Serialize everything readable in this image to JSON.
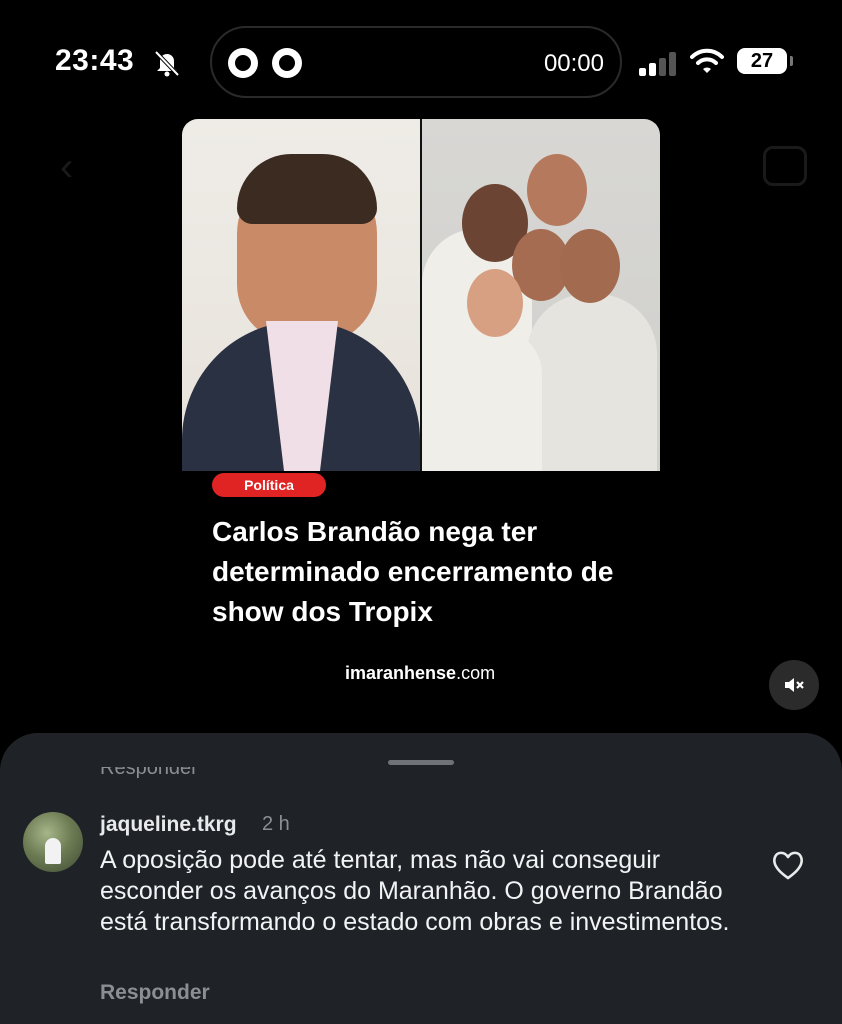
{
  "status_bar": {
    "time": "23:43",
    "timer": "00:00",
    "battery": "27"
  },
  "post": {
    "category": "Política",
    "headline": "Carlos Brandão nega ter determinado encerramento de show dos Tropix",
    "source_bold": "imaranhense",
    "source_rest": ".com"
  },
  "comments_sheet": {
    "previous_reply_label": "Responder",
    "comment": {
      "username": "jaqueline.tkrg",
      "time": "2 h",
      "text": "A oposição pode até tentar, mas não vai conseguir esconder os avanços do Maranhão. O governo Brandão está transformando o estado com obras e investimentos.",
      "reply_label": "Responder"
    }
  },
  "icons": [
    "bell-slash-icon",
    "club-crest-icon",
    "cellular-signal-icon",
    "wifi-icon",
    "battery-icon",
    "mute-icon",
    "heart-icon",
    "back-icon",
    "camera-icon"
  ],
  "colors": {
    "background": "#000000",
    "badge": "#e02424",
    "sheet": "#1f2327",
    "muted_text": "#8b8f94"
  }
}
